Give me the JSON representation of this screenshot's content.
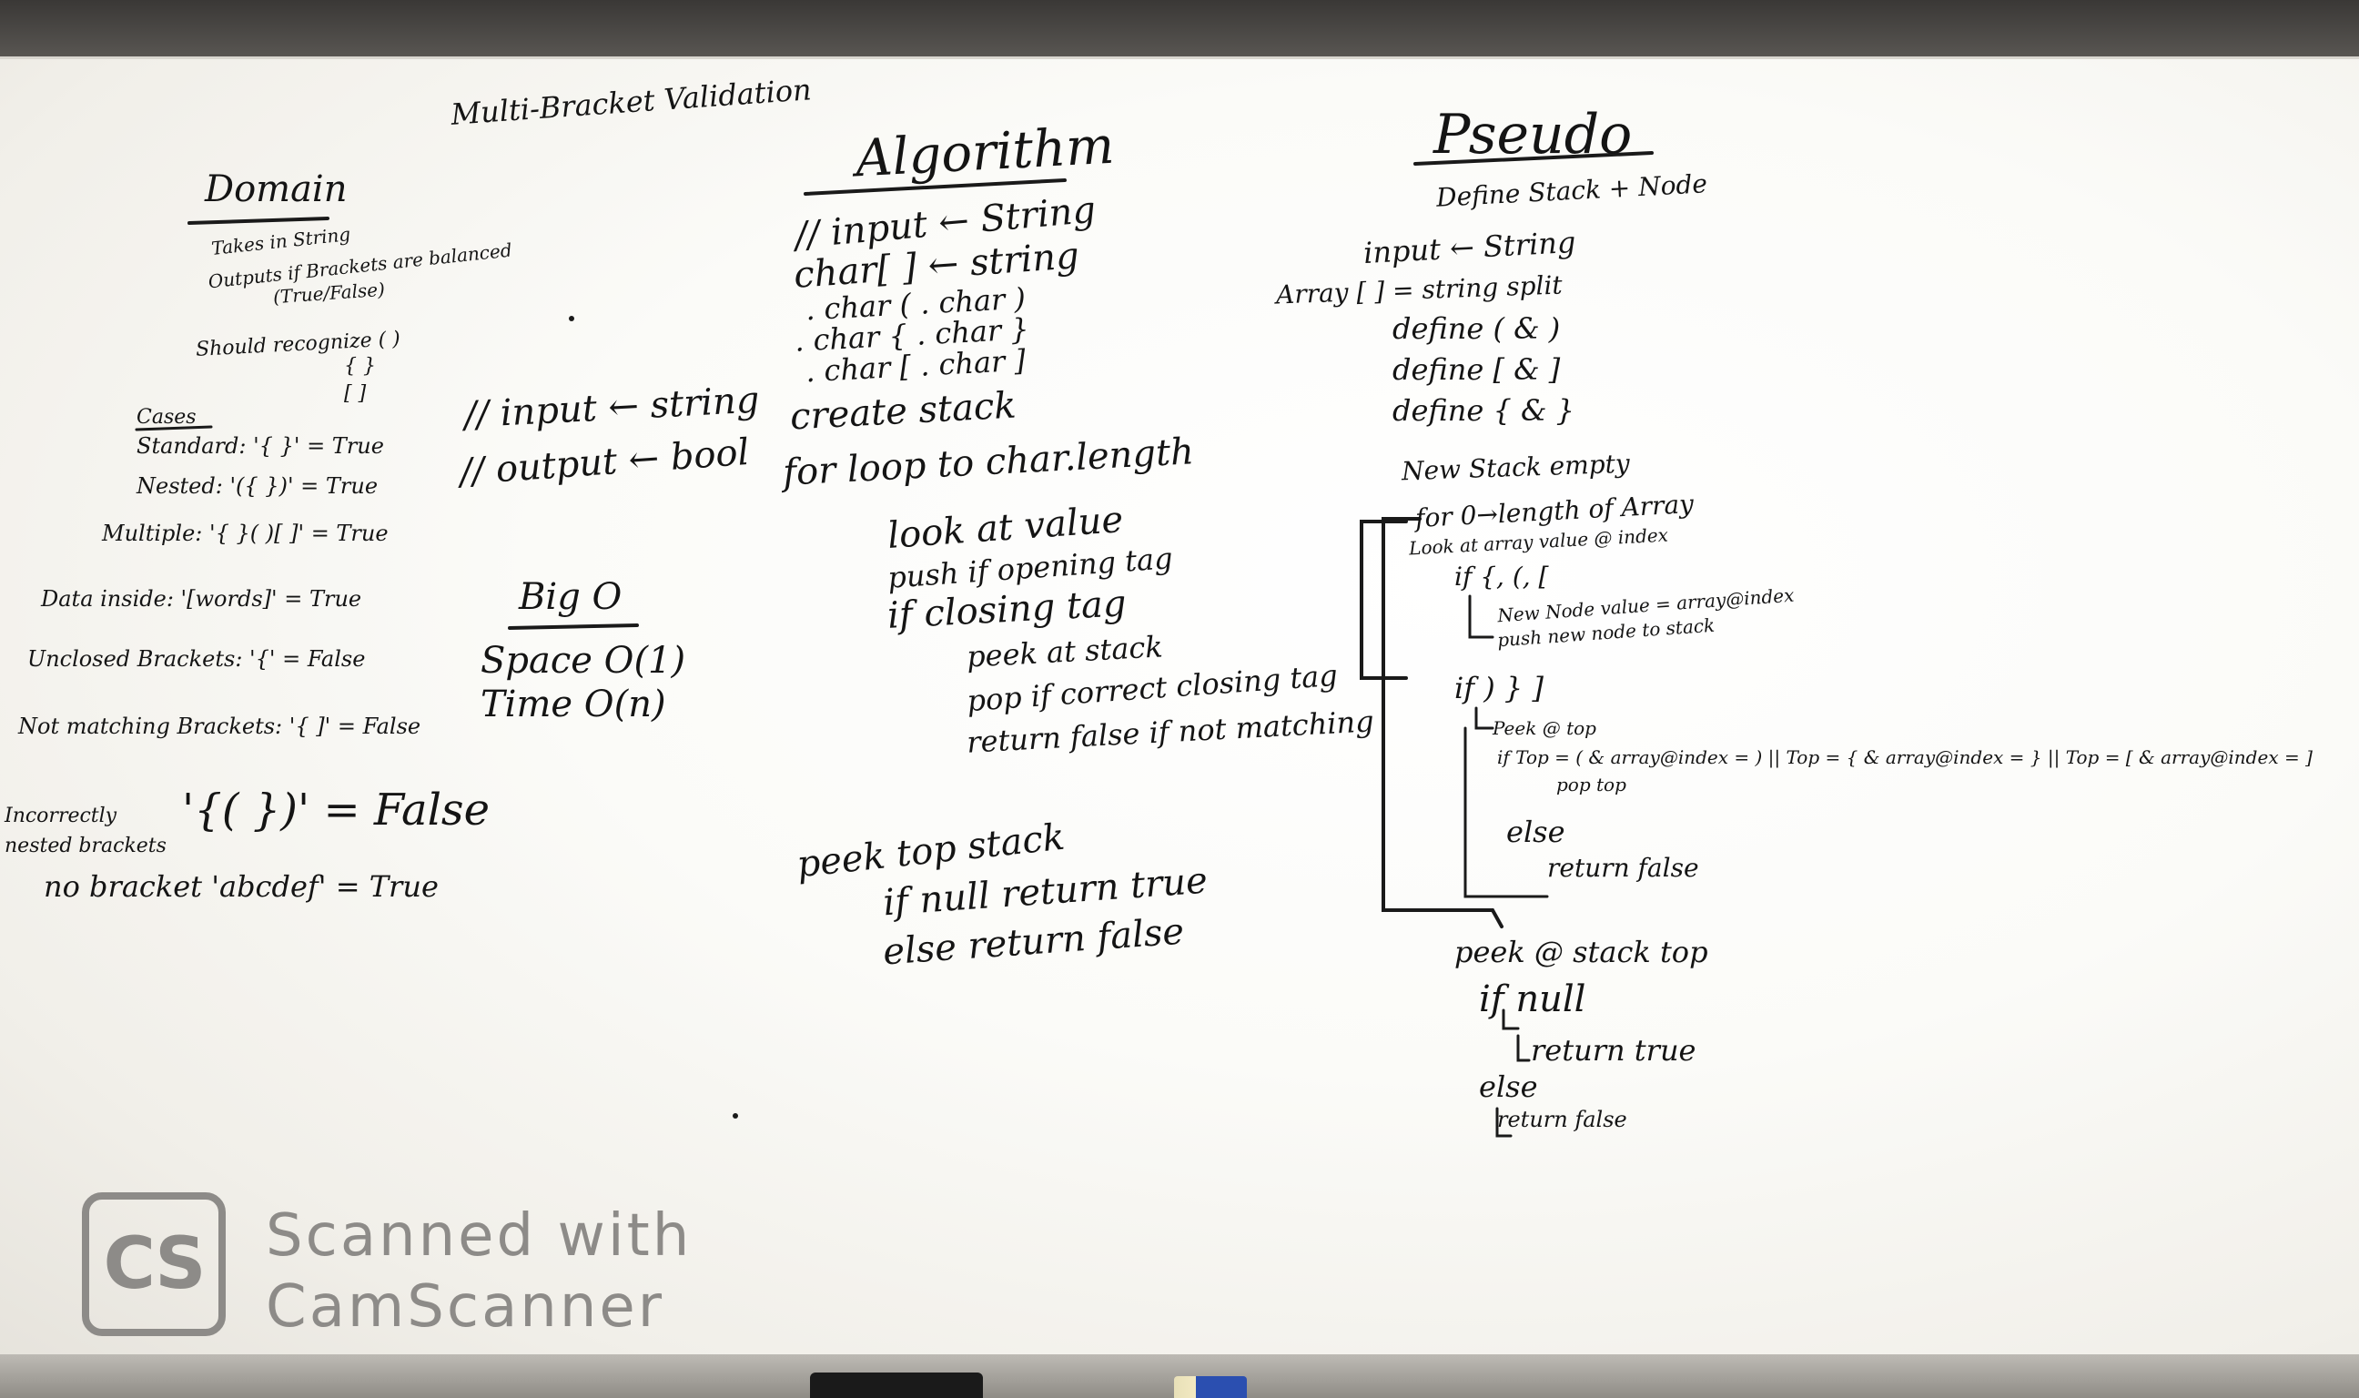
{
  "title": "Multi-Bracket Validation",
  "domain_section": {
    "heading": "Domain",
    "lines": [
      "Takes in String",
      "Outputs if Brackets are balanced",
      "(True/False)",
      "Should recognize ( )",
      "{ }",
      "[ ]",
      "Cases",
      "Standard: '{ }' = True",
      "Nested: '({ })' = True",
      "Multiple: '{ }( )[ ]' = True",
      "Data inside: '[words]' = True",
      "Unclosed Brackets: '{' = False",
      "Not matching Brackets: '{ ]' = False",
      "Incorrectly nested brackets",
      "'{( })' = False",
      "no bracket 'abcdef' = True"
    ]
  },
  "io_section": {
    "input": "// input ← string",
    "output": "// output ← bool"
  },
  "bigo_section": {
    "heading": "Big O",
    "space": "Space O(1)",
    "time": "Time O(n)"
  },
  "algorithm_section": {
    "heading": "Algorithm",
    "lines": [
      "// input ← String",
      "char[ ] ← string",
      ". char ( . char )",
      ". char { . char }",
      ". char [ . char ]",
      "create stack",
      "for loop to char.length",
      "look at value",
      "push if opening tag",
      "if closing tag",
      "peek at stack",
      "pop if correct closing tag",
      "return false if not matching",
      "peek top stack",
      "if null return true",
      "else return false"
    ]
  },
  "pseudo_section": {
    "heading": "Pseudo",
    "lines": [
      "Define Stack + Node",
      "input ← String",
      "Array [ ] = string split",
      "define ( & )",
      "define [ & ]",
      "define { & }",
      "New Stack empty",
      "for 0→length of Array",
      "Look at array value @ index",
      "if {, (, [",
      "New Node value = array@index",
      "push new node to stack",
      "if ) } ]",
      "Peek @ top",
      "if Top = ( & array@index = ) || Top = { & array@index = } || Top = [ & array@index = ]",
      "pop top",
      "else",
      "return false",
      "peek @ stack top",
      "if null",
      "return true",
      "else",
      "return false"
    ]
  },
  "watermark": {
    "logo": "CS",
    "line1": "Scanned with",
    "line2": "CamScanner"
  }
}
